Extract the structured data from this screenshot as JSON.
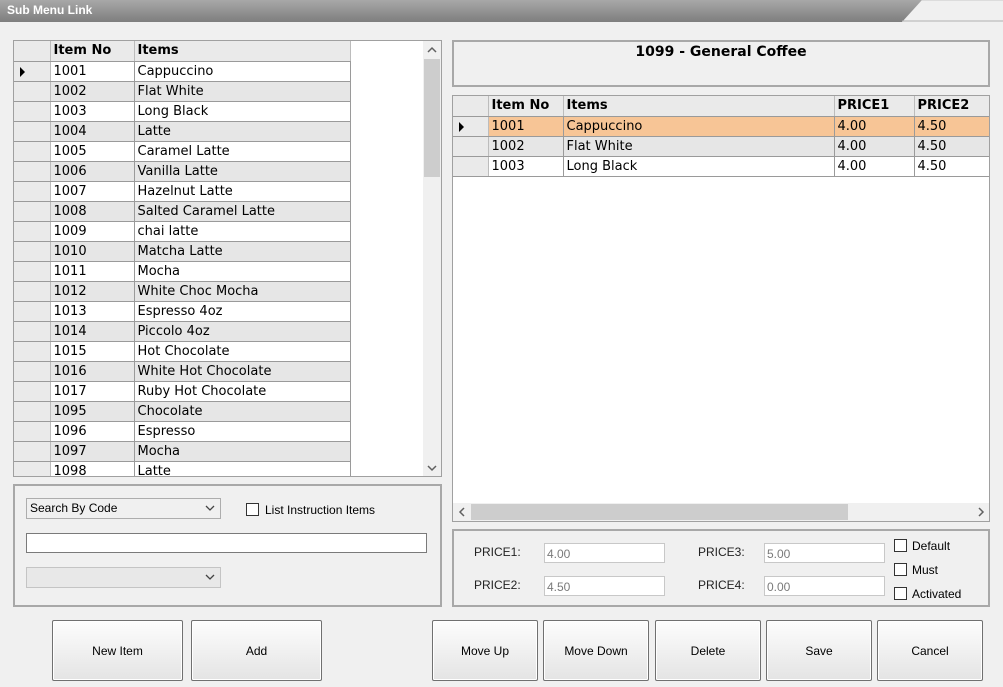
{
  "window": {
    "title": "Sub Menu Link"
  },
  "left_grid": {
    "headers": [
      "Item No",
      "Items"
    ],
    "rows": [
      [
        "1001",
        "Cappuccino"
      ],
      [
        "1002",
        "Flat White"
      ],
      [
        "1003",
        "Long Black"
      ],
      [
        "1004",
        "Latte"
      ],
      [
        "1005",
        "Caramel Latte"
      ],
      [
        "1006",
        "Vanilla Latte"
      ],
      [
        "1007",
        "Hazelnut Latte"
      ],
      [
        "1008",
        "Salted Caramel Latte"
      ],
      [
        "1009",
        "chai latte"
      ],
      [
        "1010",
        "Matcha Latte"
      ],
      [
        "1011",
        "Mocha"
      ],
      [
        "1012",
        "White Choc Mocha"
      ],
      [
        "1013",
        "Espresso 4oz"
      ],
      [
        "1014",
        "Piccolo 4oz"
      ],
      [
        "1015",
        "Hot Chocolate"
      ],
      [
        "1016",
        "White Hot Chocolate"
      ],
      [
        "1017",
        "Ruby Hot Chocolate"
      ],
      [
        "1095",
        "Chocolate"
      ],
      [
        "1096",
        "Espresso"
      ],
      [
        "1097",
        "Mocha"
      ],
      [
        "1098",
        "Latte"
      ]
    ]
  },
  "search": {
    "mode": "Search By Code",
    "list_instruction_label": "List Instruction Items",
    "query": "",
    "second_select": ""
  },
  "right_header": {
    "title": "1099 - General Coffee"
  },
  "right_grid": {
    "headers": [
      "Item No",
      "Items",
      "PRICE1",
      "PRICE2"
    ],
    "rows": [
      [
        "1001",
        "Cappuccino",
        "4.00",
        "4.50"
      ],
      [
        "1002",
        "Flat White",
        "4.00",
        "4.50"
      ],
      [
        "1003",
        "Long Black",
        "4.00",
        "4.50"
      ]
    ]
  },
  "prices": {
    "price1_label": "PRICE1:",
    "price1_value": "4.00",
    "price2_label": "PRICE2:",
    "price2_value": "4.50",
    "price3_label": "PRICE3:",
    "price3_value": "5.00",
    "price4_label": "PRICE4:",
    "price4_value": "0.00",
    "default_label": "Default",
    "must_label": "Must",
    "activated_label": "Activated"
  },
  "buttons": {
    "new_item": "New Item",
    "add": "Add",
    "move_up": "Move Up",
    "move_down": "Move Down",
    "delete": "Delete",
    "save": "Save",
    "cancel": "Cancel"
  },
  "colors": {
    "selected_row": "#f7c596",
    "title_bar": "#8f8f8f"
  }
}
